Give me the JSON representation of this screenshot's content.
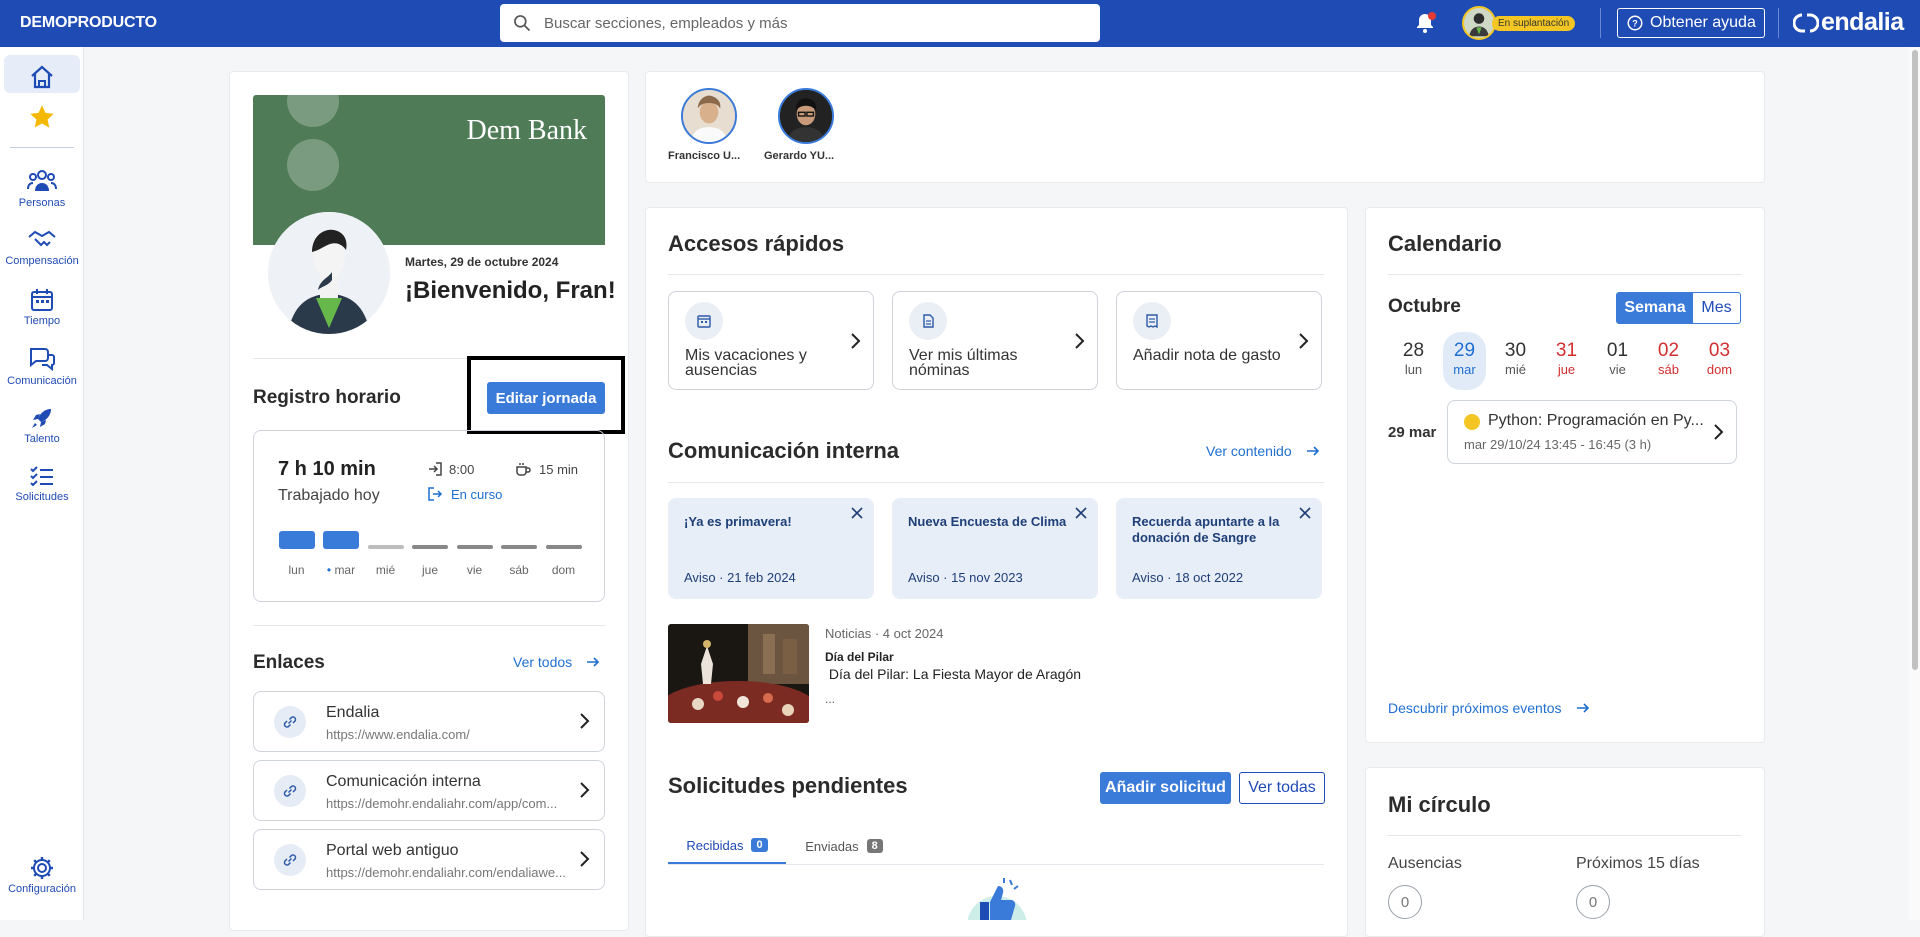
{
  "topbar": {
    "brand": "DEMOPRODUCTO",
    "search_placeholder": "Buscar secciones, empleados y más",
    "impersonation_badge": "En suplantación",
    "help_label": "Obtener ayuda",
    "logo_text": "endalia"
  },
  "sidebar": {
    "items": [
      {
        "label": "Personas"
      },
      {
        "label": "Compensación"
      },
      {
        "label": "Tiempo"
      },
      {
        "label": "Comunicación"
      },
      {
        "label": "Talento"
      },
      {
        "label": "Solicitudes"
      }
    ],
    "config_label": "Configuración"
  },
  "team": {
    "people": [
      {
        "name": "Francisco U..."
      },
      {
        "name": "Gerardo YU..."
      }
    ]
  },
  "welcome": {
    "company_logo": "Dem Bank",
    "date": "Martes, 29 de octubre 2024",
    "greeting": "¡Bienvenido, Fran!"
  },
  "work_schedule": {
    "title": "Registro horario",
    "edit_button": "Editar jornada",
    "worked_time": "7 h 10 min",
    "worked_label": "Trabajado hoy",
    "entry_time": "8:00",
    "break_time": "15 min",
    "status": "En curso",
    "days": [
      {
        "label": "lun",
        "active": true
      },
      {
        "label": "mar",
        "active": true,
        "today": true
      },
      {
        "label": "mié",
        "active": false
      },
      {
        "label": "jue",
        "active": false
      },
      {
        "label": "vie",
        "active": false
      },
      {
        "label": "sáb",
        "active": false
      },
      {
        "label": "dom",
        "active": false
      }
    ]
  },
  "links": {
    "title": "Enlaces",
    "see_all": "Ver todos",
    "items": [
      {
        "title": "Endalia",
        "url": "https://www.endalia.com/"
      },
      {
        "title": "Comunicación interna",
        "url": "https://demohr.endaliahr.com/app/com..."
      },
      {
        "title": "Portal web antiguo",
        "url": "https://demohr.endaliahr.com/endaliawe..."
      }
    ]
  },
  "quick_access": {
    "title": "Accesos rápidos",
    "items": [
      {
        "label": "Mis vacaciones y ausencias"
      },
      {
        "label": "Ver mis últimas nóminas"
      },
      {
        "label": "Añadir nota de gasto"
      }
    ]
  },
  "internal_comms": {
    "title": "Comunicación interna",
    "see_content": "Ver contenido",
    "notices": [
      {
        "title": "¡Ya es primavera!",
        "meta": "Aviso · 21 feb 2024"
      },
      {
        "title": "Nueva Encuesta de Clima",
        "meta": "Aviso · 15 nov 2023"
      },
      {
        "title": "Recuerda apuntarte a la donación de Sangre",
        "meta": "Aviso · 18 oct 2022"
      }
    ],
    "news": {
      "meta": "Noticias · 4 oct 2024",
      "title": "Día del Pilar",
      "subtitle": " Día del Pilar: La Fiesta Mayor de Aragón",
      "excerpt": "..."
    }
  },
  "requests": {
    "title": "Solicitudes pendientes",
    "add_button": "Añadir solicitud",
    "see_all_button": "Ver todas",
    "tabs": [
      {
        "label": "Recibidas",
        "count": "0"
      },
      {
        "label": "Enviadas",
        "count": "8"
      }
    ]
  },
  "calendar": {
    "title": "Calendario",
    "month": "Octubre",
    "view_week": "Semana",
    "view_month": "Mes",
    "days": [
      {
        "num": "28",
        "label": "lun"
      },
      {
        "num": "29",
        "label": "mar"
      },
      {
        "num": "30",
        "label": "mié"
      },
      {
        "num": "31",
        "label": "jue"
      },
      {
        "num": "01",
        "label": "vie"
      },
      {
        "num": "02",
        "label": "sáb"
      },
      {
        "num": "03",
        "label": "dom"
      }
    ],
    "event_date": "29 mar",
    "event_title": "Python: Programación en Py...",
    "event_time": "mar 29/10/24 13:45 - 16:45 (3 h)",
    "discover": "Descubrir próximos eventos"
  },
  "circle": {
    "title": "Mi círculo",
    "absences_label": "Ausencias",
    "absences_count": "0",
    "next_label": "Próximos 15 días",
    "next_count": "0"
  },
  "colors": {
    "brand_blue": "#1f4bb5",
    "accent_blue": "#3a7ad8",
    "weekend_red": "#d32f2f",
    "banner_green": "#4f7c57",
    "event_yellow": "#f3c623"
  }
}
